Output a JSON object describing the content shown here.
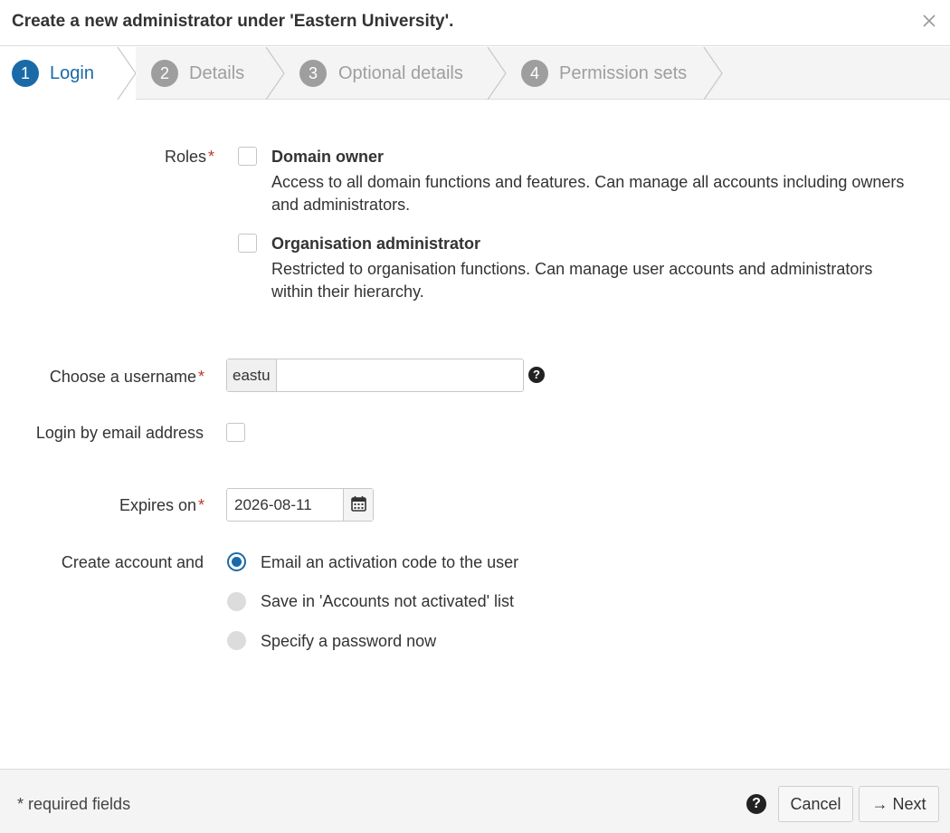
{
  "dialog": {
    "title": "Create a new administrator under 'Eastern University'."
  },
  "wizard": {
    "steps": [
      {
        "number": "1",
        "label": "Login",
        "active": true
      },
      {
        "number": "2",
        "label": "Details",
        "active": false
      },
      {
        "number": "3",
        "label": "Optional details",
        "active": false
      },
      {
        "number": "4",
        "label": "Permission sets",
        "active": false
      }
    ]
  },
  "form": {
    "roles": {
      "label": "Roles",
      "required_mark": "*",
      "options": [
        {
          "title": "Domain owner",
          "description": "Access to all domain functions and features. Can manage all accounts including owners and administrators.",
          "checked": false
        },
        {
          "title": "Organisation administrator",
          "description": "Restricted to organisation functions. Can manage user accounts and administrators within their hierarchy.",
          "checked": false
        }
      ]
    },
    "username": {
      "label": "Choose a username",
      "required_mark": "*",
      "prefix": "eastu",
      "value": ""
    },
    "login_by_email": {
      "label": "Login by email address",
      "checked": false
    },
    "expires": {
      "label": "Expires on",
      "required_mark": "*",
      "value": "2026-08-11"
    },
    "create_account": {
      "label": "Create account and",
      "options": [
        {
          "label": "Email an activation code to the user",
          "selected": true
        },
        {
          "label": "Save in 'Accounts not activated' list",
          "selected": false
        },
        {
          "label": "Specify a password now",
          "selected": false
        }
      ]
    }
  },
  "footer": {
    "required_note": "* required fields",
    "help_icon": "?",
    "cancel_label": "Cancel",
    "next_label": "Next",
    "next_arrow": "→"
  },
  "colors": {
    "accent": "#1a6aa8",
    "inactive_step": "#9e9e9e",
    "required": "#c0392b"
  }
}
